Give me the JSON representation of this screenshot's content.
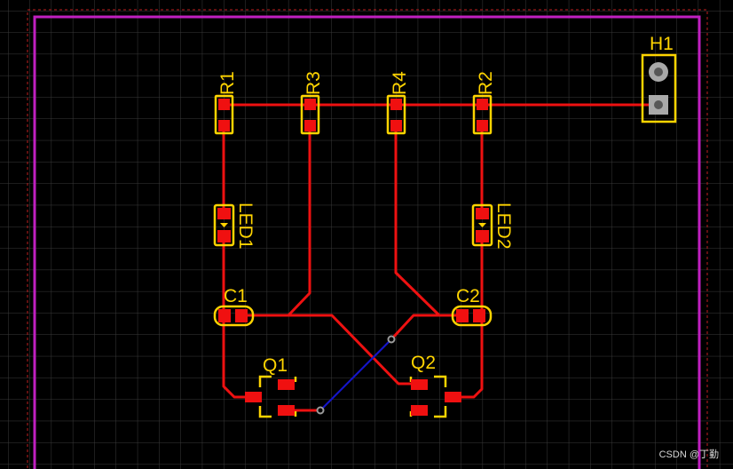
{
  "designators": {
    "r1": "R1",
    "r2": "R2",
    "r3": "R3",
    "r4": "R4",
    "led1": "LED1",
    "led2": "LED2",
    "c1": "C1",
    "c2": "C2",
    "q1": "Q1",
    "q2": "Q2",
    "h1": "H1"
  },
  "watermark": "CSDN @丁勤",
  "colors": {
    "background": "#000000",
    "board_outline": "#c020c0",
    "keepout": "#c02020",
    "grid": "#3a3a3a",
    "top_copper": "#ee1111",
    "bottom_copper": "#1515c8",
    "silkscreen": "#ffd400",
    "via": "#9a9a9a"
  }
}
